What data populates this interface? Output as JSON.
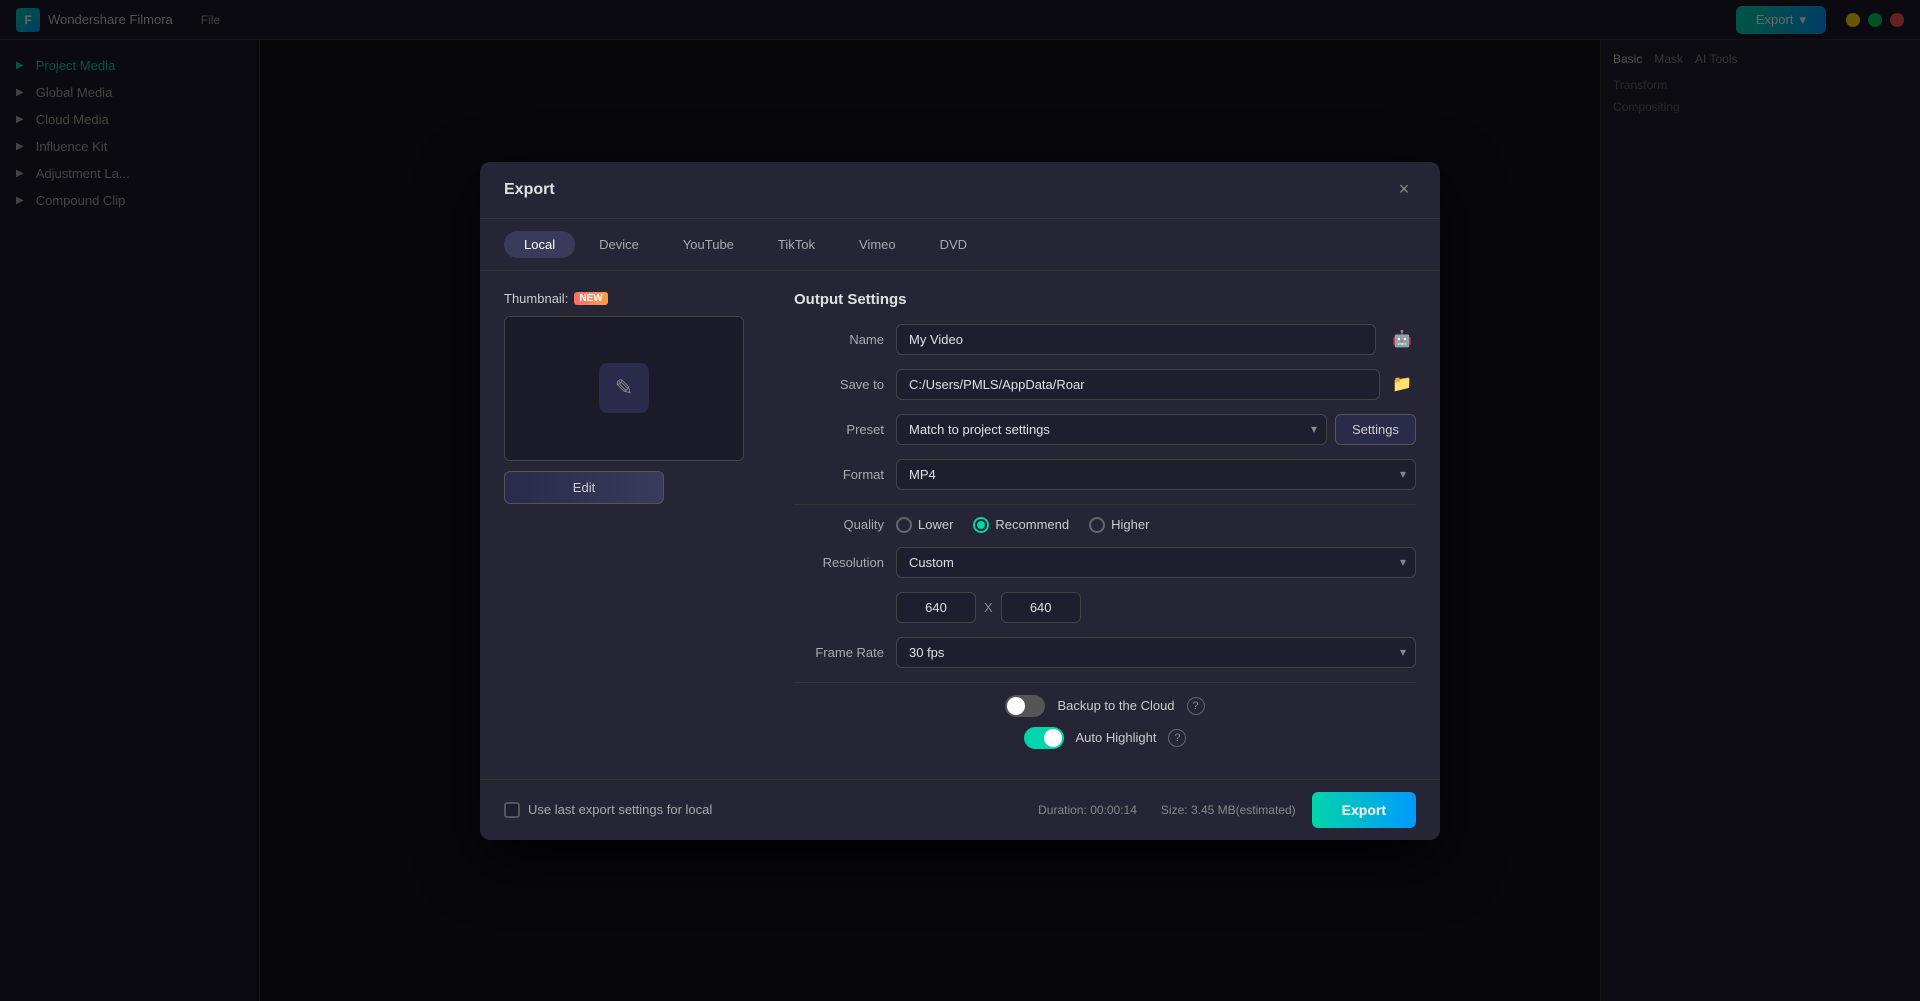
{
  "app": {
    "title": "Wondershare Filmora",
    "menu_items": [
      "File"
    ],
    "export_btn_label": "Export"
  },
  "dialog": {
    "title": "Export",
    "close_label": "×",
    "tabs": [
      {
        "id": "local",
        "label": "Local",
        "active": true
      },
      {
        "id": "device",
        "label": "Device"
      },
      {
        "id": "youtube",
        "label": "YouTube"
      },
      {
        "id": "tiktok",
        "label": "TikTok"
      },
      {
        "id": "vimeo",
        "label": "Vimeo"
      },
      {
        "id": "dvd",
        "label": "DVD"
      }
    ],
    "thumbnail": {
      "label": "Thumbnail:",
      "new_badge": "NEW",
      "edit_btn": "Edit"
    },
    "output": {
      "title": "Output Settings",
      "name_label": "Name",
      "name_value": "My Video",
      "save_to_label": "Save to",
      "save_to_value": "C:/Users/PMLS/AppData/Roar",
      "preset_label": "Preset",
      "preset_value": "Match to project settings",
      "settings_btn": "Settings",
      "format_label": "Format",
      "format_value": "MP4",
      "quality_label": "Quality",
      "quality_options": [
        {
          "id": "lower",
          "label": "Lower",
          "checked": false
        },
        {
          "id": "recommend",
          "label": "Recommend",
          "checked": true
        },
        {
          "id": "higher",
          "label": "Higher",
          "checked": false
        }
      ],
      "resolution_label": "Resolution",
      "resolution_value": "Custom",
      "res_width": "640",
      "res_height": "640",
      "framerate_label": "Frame Rate",
      "framerate_value": "30 fps",
      "backup_cloud_label": "Backup to the Cloud",
      "backup_cloud_on": true,
      "auto_highlight_label": "Auto Highlight",
      "auto_highlight_on": true
    },
    "footer": {
      "use_last_label": "Use last export settings for local",
      "duration_label": "Duration:",
      "duration_value": "00:00:14",
      "size_label": "Size:",
      "size_value": "3.45 MB(estimated)",
      "export_btn": "Export"
    }
  },
  "sidebar": {
    "items": [
      {
        "label": "Project Media",
        "active": true
      },
      {
        "label": "Global Media"
      },
      {
        "label": "Cloud Media"
      },
      {
        "label": "Influence Kit"
      },
      {
        "label": "Adjustment La..."
      },
      {
        "label": "Compound Clip"
      }
    ]
  },
  "right_panel": {
    "tabs": [
      "Basic",
      "Mask",
      "AI Tools"
    ],
    "sections": [
      "Transform",
      "Compositing"
    ]
  }
}
